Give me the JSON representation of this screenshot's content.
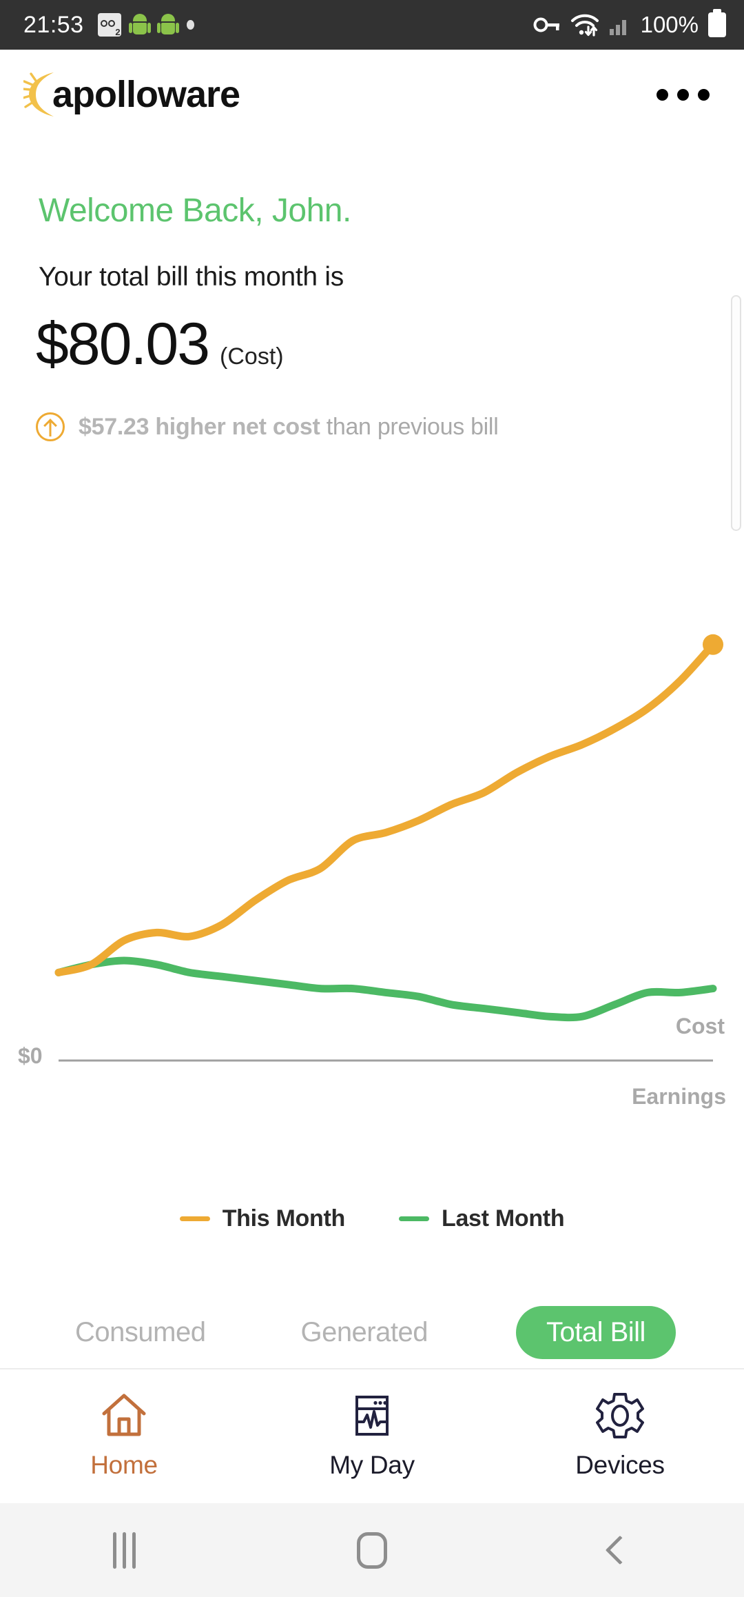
{
  "status_bar": {
    "time": "21:53",
    "battery_percent": "100%",
    "left_icons": [
      "voicemail-icon",
      "android-icon",
      "android-icon",
      "dot-icon"
    ],
    "right_icons": [
      "vpn-key-icon",
      "wifi-icon",
      "signal-bars-icon",
      "battery-icon"
    ]
  },
  "header": {
    "logo_text": "apolloware",
    "overflow_menu": "more-options"
  },
  "main": {
    "welcome": "Welcome Back, John.",
    "subtitle": "Your total bill this month is",
    "amount": "$80.03",
    "amount_unit": "(Cost)",
    "delta_value": "$57.23 higher net cost",
    "delta_suffix": " than previous bill",
    "delta_direction": "up"
  },
  "chart_axis": {
    "zero_label": "$0",
    "cost_label": "Cost",
    "earnings_label": "Earnings"
  },
  "legend": [
    {
      "label": "This Month",
      "color": "#eeaa33"
    },
    {
      "label": "Last Month",
      "color": "#4cb964"
    }
  ],
  "tabs": [
    {
      "label": "Consumed",
      "active": false
    },
    {
      "label": "Generated",
      "active": false
    },
    {
      "label": "Total Bill",
      "active": true
    }
  ],
  "bottom_nav": [
    {
      "label": "Home",
      "icon": "house-icon",
      "active": true
    },
    {
      "label": "My Day",
      "icon": "monitor-pulse-icon",
      "active": false
    },
    {
      "label": "Devices",
      "icon": "gear-icon",
      "active": false
    }
  ],
  "system_nav": [
    "recents-button",
    "home-button",
    "back-button"
  ],
  "colors": {
    "accent_green": "#5cc46e",
    "line_orange": "#eeaa33",
    "line_green": "#4cb964",
    "nav_active": "#c2703c",
    "muted_gray": "#a9a9a9"
  },
  "chart_data": {
    "type": "line",
    "title": "",
    "xlabel": "",
    "ylabel": "",
    "grid": false,
    "legend_position": "bottom-center",
    "annotations": [
      {
        "text": "Cost",
        "position": "above-zero-axis-right"
      },
      {
        "text": "Earnings",
        "position": "below-zero-axis-right"
      },
      {
        "text": "$0",
        "position": "zero-axis-left"
      }
    ],
    "zero_line": 0,
    "x": [
      0,
      1,
      2,
      3,
      4,
      5,
      6,
      7,
      8,
      9,
      10,
      11,
      12,
      13,
      14,
      15,
      16,
      17,
      18,
      19,
      20
    ],
    "series": [
      {
        "name": "This Month",
        "color": "#eeaa33",
        "end_marker": true,
        "values": [
          22,
          24,
          30,
          32,
          31,
          34,
          40,
          45,
          48,
          55,
          57,
          60,
          64,
          67,
          72,
          76,
          79,
          83,
          88,
          95,
          104
        ]
      },
      {
        "name": "Last Month",
        "color": "#4cb964",
        "end_marker": false,
        "values": [
          22,
          24,
          25,
          24,
          22,
          21,
          20,
          19,
          18,
          18,
          17,
          16,
          14,
          13,
          12,
          11,
          11,
          14,
          17,
          17,
          18
        ]
      }
    ],
    "ylim": [
      0,
      110
    ],
    "units": "USD"
  }
}
